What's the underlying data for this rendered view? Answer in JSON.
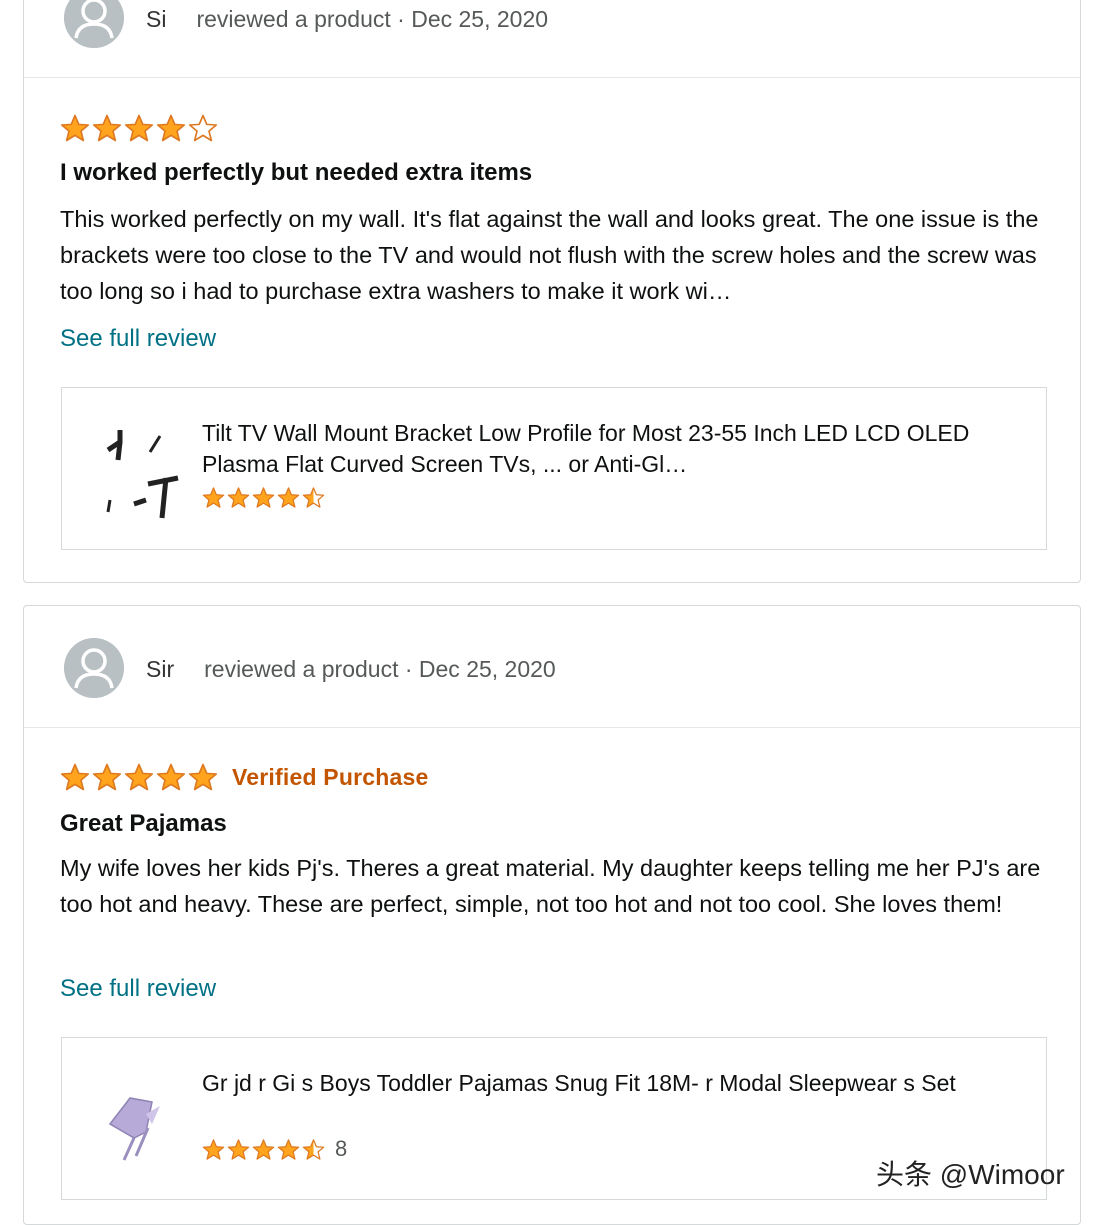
{
  "reviews": [
    {
      "reviewer_name": "Si",
      "reviewed_label": "reviewed a product · Dec 25, 2020",
      "rating": 4,
      "max_rating": 5,
      "verified_label": "",
      "title": "I worked perfectly but needed extra items",
      "body": "This worked perfectly on my wall. It's flat against the wall and looks great. The one issue is the brackets were too close to the TV and would not flush with the screw holes and the screw was too long so i had to purchase extra washers to make it work wi…",
      "see_full_label": "See full review",
      "product": {
        "title": "Tilt TV Wall Mount Bracket Low Profile for Most 23-55 Inch LED LCD OLED Plasma Flat Curved Screen TVs, ... or Anti-Gl…",
        "rating": 4.5,
        "rating_count": "",
        "thumb_icon": "tv-mount-bracket-icon"
      }
    },
    {
      "reviewer_name": "Sir",
      "reviewed_label": "reviewed a product · Dec 25, 2020",
      "rating": 5,
      "max_rating": 5,
      "verified_label": "Verified Purchase",
      "title": "Great Pajamas",
      "body": "My wife loves her kids Pj's. Theres a great material. My daughter keeps telling me her PJ's are too hot and heavy. These are perfect, simple, not too hot and not too cool. She loves them!",
      "see_full_label": "See full review",
      "product": {
        "title": "Gr jd r Gi s Boys Toddler Pajamas Snug Fit 18M- r Modal Sleepwear s Set",
        "rating": 4.5,
        "rating_count": "8",
        "thumb_icon": "pajamas-icon"
      }
    }
  ],
  "watermark": "头条 @Wimoor",
  "colors": {
    "star": "#ffa41c",
    "star_outline": "#de7921",
    "link": "#007185",
    "verified": "#c45500",
    "avatar": "#b9c0c4"
  }
}
